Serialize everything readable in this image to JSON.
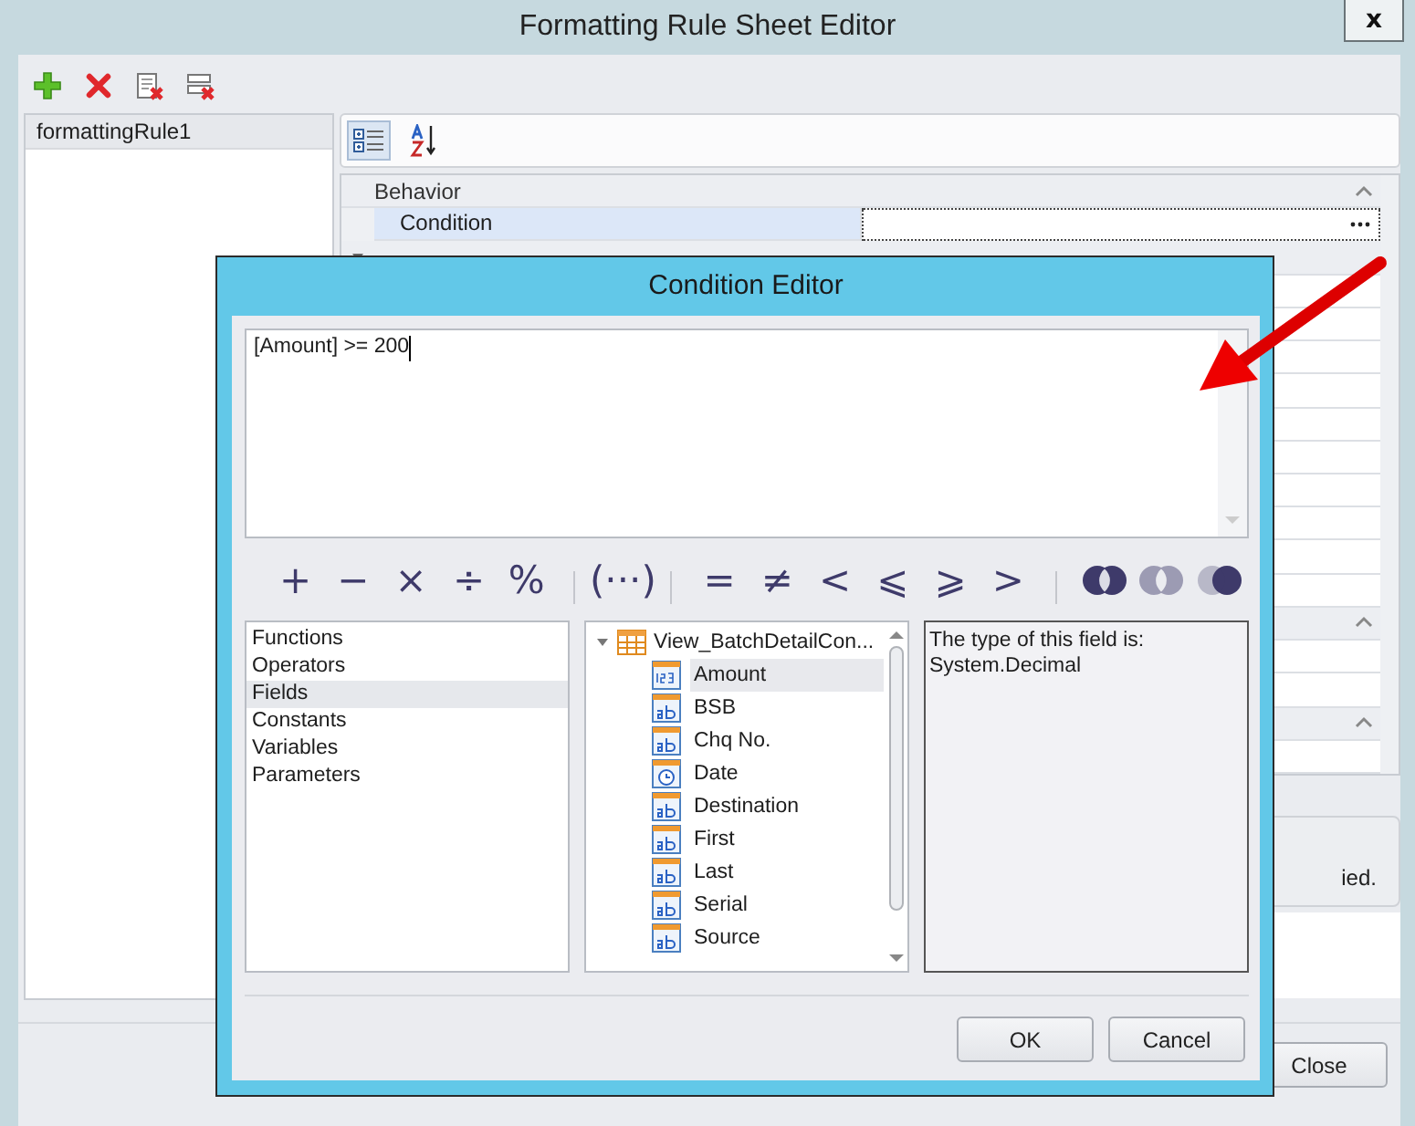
{
  "window": {
    "title": "Formatting Rule Sheet Editor",
    "close_label": "x"
  },
  "toolbar": [
    {
      "kind": "add"
    },
    {
      "kind": "delete"
    },
    {
      "kind": "delete-sheet"
    },
    {
      "kind": "delete-all"
    }
  ],
  "rules": [
    {
      "label": "formattingRule1",
      "selected": true
    }
  ],
  "property_toolbar": [
    {
      "kind": "categorized",
      "selected": true
    },
    {
      "kind": "alphabetical",
      "selected": false
    }
  ],
  "property_grid": {
    "rows": [
      {
        "kind": "category",
        "label": "Behavior",
        "expanded": true
      },
      {
        "kind": "property",
        "label": "Condition",
        "selected": true,
        "has_editor": true
      },
      {
        "kind": "subcategory",
        "expanded": true
      },
      {
        "kind": "property"
      },
      {
        "kind": "property"
      },
      {
        "kind": "property"
      },
      {
        "kind": "property"
      },
      {
        "kind": "property"
      },
      {
        "kind": "property"
      },
      {
        "kind": "property"
      },
      {
        "kind": "property"
      },
      {
        "kind": "property"
      },
      {
        "kind": "property"
      },
      {
        "kind": "category",
        "expanded": true
      },
      {
        "kind": "property"
      },
      {
        "kind": "property"
      },
      {
        "kind": "category",
        "expanded": true
      },
      {
        "kind": "property"
      }
    ]
  },
  "description": {
    "text": "ied."
  },
  "footer": {
    "close_button": "Close"
  },
  "dialog": {
    "title": "Condition Editor",
    "expression": "[Amount] >= 200",
    "operators": [
      {
        "kind": "text",
        "label": "+"
      },
      {
        "kind": "text",
        "label": "−"
      },
      {
        "kind": "text",
        "label": "×"
      },
      {
        "kind": "text",
        "label": "÷"
      },
      {
        "kind": "text",
        "label": "%"
      },
      {
        "kind": "separator"
      },
      {
        "kind": "text",
        "label": "(···)"
      },
      {
        "kind": "separator"
      },
      {
        "kind": "text",
        "label": "="
      },
      {
        "kind": "text",
        "label": "≠"
      },
      {
        "kind": "text",
        "label": "<"
      },
      {
        "kind": "text",
        "label": "⩽"
      },
      {
        "kind": "text",
        "label": "⩾"
      },
      {
        "kind": "text",
        "label": ">"
      },
      {
        "kind": "separator"
      },
      {
        "kind": "venn-both",
        "disabled": false
      },
      {
        "kind": "venn-outer",
        "disabled": true
      },
      {
        "kind": "venn-right",
        "disabled": false
      }
    ],
    "categories": [
      {
        "label": "Functions",
        "selected": false
      },
      {
        "label": "Operators",
        "selected": false
      },
      {
        "label": "Fields",
        "selected": true
      },
      {
        "label": "Constants",
        "selected": false
      },
      {
        "label": "Variables",
        "selected": false
      },
      {
        "label": "Parameters",
        "selected": false
      }
    ],
    "tree": {
      "label": "View_BatchDetailCon...",
      "expanded": true,
      "children": [
        {
          "label": "Amount",
          "kind": "number",
          "selected": true
        },
        {
          "label": "BSB",
          "kind": "text",
          "selected": false
        },
        {
          "label": "Chq No.",
          "kind": "text",
          "selected": false
        },
        {
          "label": "Date",
          "kind": "date",
          "selected": false
        },
        {
          "label": "Destination",
          "kind": "text",
          "selected": false
        },
        {
          "label": "First",
          "kind": "text",
          "selected": false
        },
        {
          "label": "Last",
          "kind": "text",
          "selected": false
        },
        {
          "label": "Serial",
          "kind": "text",
          "selected": false
        },
        {
          "label": "Source",
          "kind": "text",
          "selected": false
        }
      ]
    },
    "info": [
      "The type of this field is:",
      "System.Decimal"
    ],
    "buttons": [
      "OK",
      "Cancel"
    ]
  }
}
